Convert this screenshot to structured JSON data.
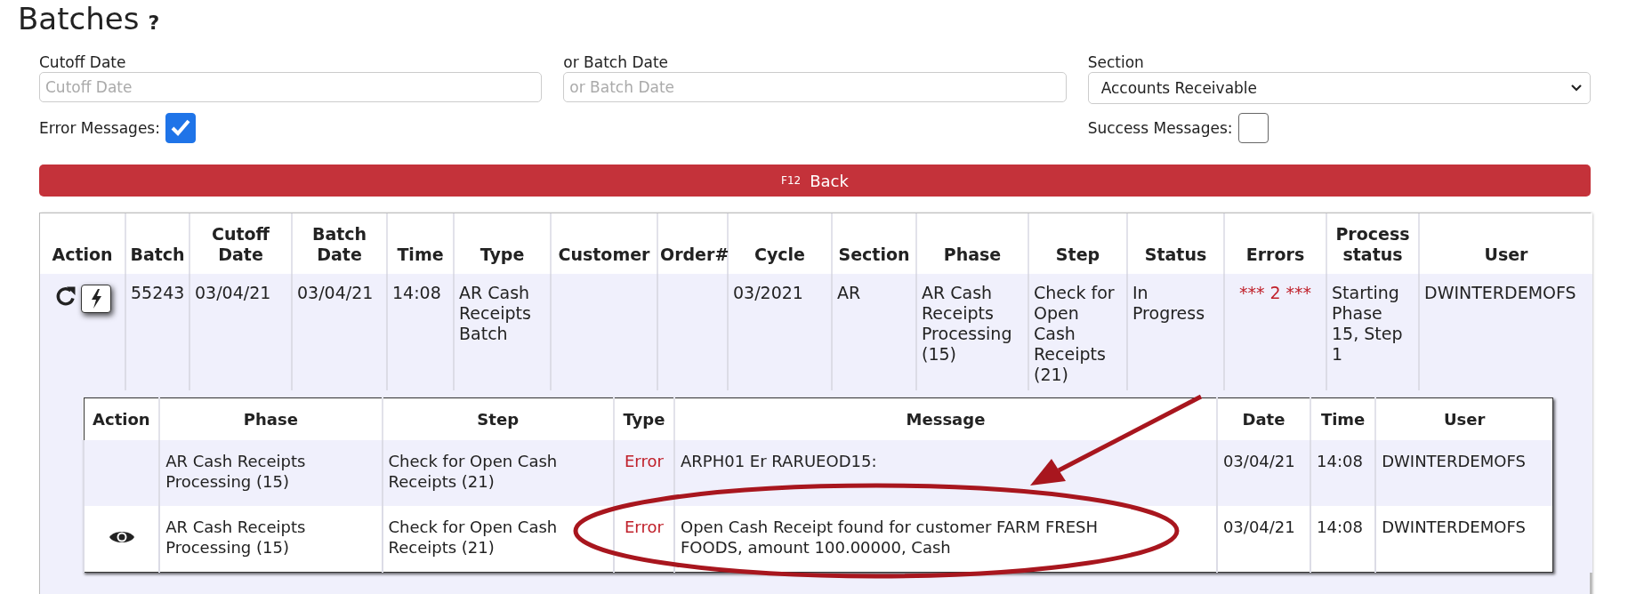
{
  "page": {
    "title": "Batches",
    "help": "?"
  },
  "filters": {
    "cutoff_date": {
      "label": "Cutoff Date",
      "placeholder": "Cutoff Date"
    },
    "batch_date": {
      "label": "or Batch Date",
      "placeholder": "or Batch Date"
    },
    "section": {
      "label": "Section",
      "value": "Accounts Receivable"
    },
    "error_messages": {
      "label": "Error Messages:",
      "checked": true
    },
    "success_messages": {
      "label": "Success Messages:",
      "checked": false
    }
  },
  "back_button": {
    "key": "F12",
    "label": "Back"
  },
  "batch_table": {
    "columns": [
      "Action",
      "Batch",
      "Cutoff Date",
      "Batch Date",
      "Time",
      "Type",
      "Customer",
      "Order#",
      "Cycle",
      "Section",
      "Phase",
      "Step",
      "Status",
      "Errors",
      "Process status",
      "User"
    ],
    "rows": [
      {
        "actions": [
          {
            "kind": "refresh"
          },
          {
            "kind": "run"
          }
        ],
        "cells": [
          {
            "text": ""
          },
          {
            "text": "55243",
            "alert": false
          },
          {
            "text": "03/04/21",
            "alert": false
          },
          {
            "text": "03/04/21",
            "alert": false
          },
          {
            "text": "14:08",
            "alert": false
          },
          {
            "text": "AR Cash Receipts Batch",
            "alert": false
          },
          {
            "text": ""
          },
          {
            "text": ""
          },
          {
            "text": "03/2021",
            "alert": false
          },
          {
            "text": "AR",
            "alert": false
          },
          {
            "text": "AR Cash Receipts Processing (15)",
            "alert": false
          },
          {
            "text": "Check for Open Cash Receipts (21)",
            "alert": false
          },
          {
            "text": "In Progress",
            "alert": false
          },
          {
            "text": "*** 2 ***",
            "alert": true
          },
          {
            "text": "Starting Phase 15, Step 1",
            "alert": false
          },
          {
            "text": "DWINTERDEMOFS",
            "alert": false
          }
        ],
        "messages": {
          "columns": [
            "Action",
            "Phase",
            "Step",
            "Type",
            "Message",
            "Date",
            "Time",
            "User"
          ],
          "rows": [
            {
              "cells": [
                {
                  "text": ""
                },
                {
                  "text": "AR Cash Receipts Processing (15)",
                  "alert": false
                },
                {
                  "text": "Check for Open Cash Receipts (21)",
                  "alert": false
                },
                {
                  "text": "Error",
                  "alert": true
                },
                {
                  "text": "ARPH01 Er RARUEOD15:",
                  "alert": false
                },
                {
                  "text": "03/04/21",
                  "alert": false
                },
                {
                  "text": "14:08",
                  "alert": false
                },
                {
                  "text": "DWINTERDEMOFS",
                  "alert": false
                }
              ]
            },
            {
              "actions": [
                {
                  "kind": "view"
                }
              ],
              "cells": [
                {
                  "text": ""
                },
                {
                  "text": "AR Cash Receipts Processing (15)",
                  "alert": false
                },
                {
                  "text": "Check for Open Cash Receipts (21)",
                  "alert": false
                },
                {
                  "text": "Error",
                  "alert": true
                },
                {
                  "text": "Open Cash Receipt found for customer FARM FRESH FOODS, amount 100.00000, Cash",
                  "alert": false
                },
                {
                  "text": "03/04/21",
                  "alert": false
                },
                {
                  "text": "14:08",
                  "alert": false
                },
                {
                  "text": "DWINTERDEMOFS",
                  "alert": false
                }
              ]
            }
          ]
        }
      }
    ]
  }
}
